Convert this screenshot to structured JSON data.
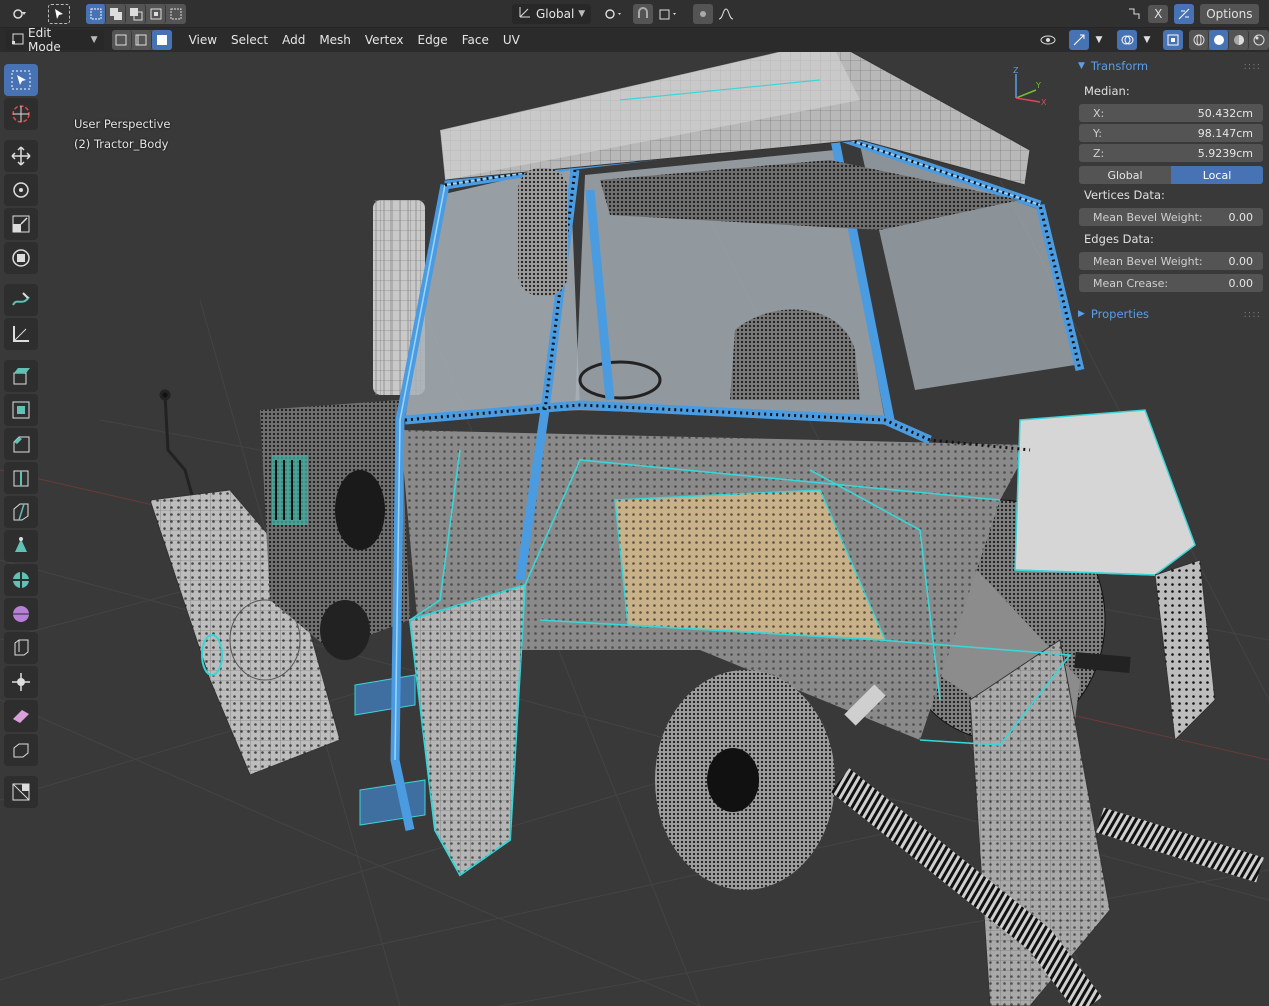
{
  "topbar": {
    "orientation_dropdown": "Global",
    "options_label": "Options",
    "x_label": "X"
  },
  "header": {
    "mode_dropdown": "Edit Mode",
    "menus": [
      "View",
      "Select",
      "Add",
      "Mesh",
      "Vertex",
      "Edge",
      "Face",
      "UV"
    ]
  },
  "viewport": {
    "perspective_label": "User Perspective",
    "object_label": "(2) Tractor_Body"
  },
  "gizmo": {
    "z": "Z",
    "y": "Y",
    "x": "X"
  },
  "npanel": {
    "transform_title": "Transform",
    "median_label": "Median:",
    "x_label": "X:",
    "x_value": "50.432cm",
    "y_label": "Y:",
    "y_value": "98.147cm",
    "z_label": "Z:",
    "z_value": "5.9239cm",
    "global_label": "Global",
    "local_label": "Local",
    "vertices_data_label": "Vertices Data:",
    "mean_bevel_weight_label": "Mean Bevel Weight:",
    "vertex_bevel_value": "0.00",
    "edges_data_label": "Edges Data:",
    "edge_bevel_value": "0.00",
    "mean_crease_label": "Mean Crease:",
    "crease_value": "0.00",
    "properties_title": "Properties"
  },
  "colors": {
    "selection_blue": "#4772b3",
    "header_link_blue": "#5c9de8",
    "edge_cyan": "#39d6d8",
    "mesh_gray": "#9a9a9a"
  },
  "icons": [
    "editor-type-icon",
    "select-box-icon",
    "select-mode-icons",
    "transform-orientation-icon",
    "pivot-icon",
    "snap-icon",
    "proportional-icon",
    "visibility-icon",
    "gizmo-icon",
    "overlay-icon",
    "xray-icon",
    "shading-icons",
    "cursor-tool-icon",
    "move-icon",
    "rotate-icon",
    "scale-icon",
    "transform-icon",
    "annotate-icon",
    "measure-icon",
    "extrude-icon",
    "inset-icon",
    "bevel-icon",
    "loopcut-icon",
    "knife-icon",
    "polybuild-icon",
    "spin-icon",
    "smooth-icon",
    "edge-slide-icon",
    "shrink-icon",
    "shear-icon",
    "rip-icon",
    "add-cube-icon"
  ]
}
